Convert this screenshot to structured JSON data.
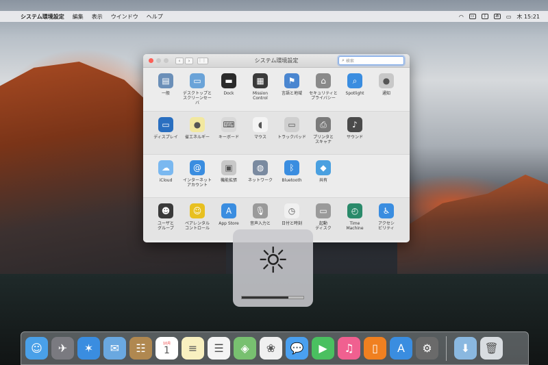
{
  "menubar": {
    "app_name": "システム環境設定",
    "items": [
      "編集",
      "表示",
      "ウインドウ",
      "ヘルプ"
    ],
    "clock": "木 15:21",
    "input_label": "あ"
  },
  "window": {
    "title": "システム環境設定",
    "search_placeholder": "検索"
  },
  "sections": [
    [
      {
        "label": "一般",
        "icon": "general-icon",
        "color": "#6b8fb8",
        "glyph": "▤"
      },
      {
        "label": "デスクトップと\nスクリーンセーバ",
        "icon": "desktop-icon",
        "color": "#6aa3d8",
        "glyph": "▭"
      },
      {
        "label": "Dock",
        "icon": "dock-icon",
        "color": "#2b2b2b",
        "glyph": "▬"
      },
      {
        "label": "Mission\nControl",
        "icon": "mission-control-icon",
        "color": "#3a3a3a",
        "glyph": "▦"
      },
      {
        "label": "言語と地域",
        "icon": "language-icon",
        "color": "#4a86d0",
        "glyph": "⚑"
      },
      {
        "label": "セキュリティと\nプライバシー",
        "icon": "security-icon",
        "color": "#8a8a8a",
        "glyph": "⌂"
      },
      {
        "label": "Spotlight",
        "icon": "spotlight-icon",
        "color": "#3a8de0",
        "glyph": "⌕"
      },
      {
        "label": "通知",
        "icon": "notifications-icon",
        "color": "#c8c8c8",
        "glyph": "●"
      }
    ],
    [
      {
        "label": "ディスプレイ",
        "icon": "display-icon",
        "color": "#2a6fc0",
        "glyph": "▭"
      },
      {
        "label": "省エネルギー",
        "icon": "energy-saver-icon",
        "color": "#f2e8a0",
        "glyph": "●"
      },
      {
        "label": "キーボード",
        "icon": "keyboard-icon",
        "color": "#d8d8d8",
        "glyph": "⌨"
      },
      {
        "label": "マウス",
        "icon": "mouse-icon",
        "color": "#f4f4f4",
        "glyph": "◖"
      },
      {
        "label": "トラックパッド",
        "icon": "trackpad-icon",
        "color": "#cfcfcf",
        "glyph": "▭"
      },
      {
        "label": "プリンタと\nスキャナ",
        "icon": "printer-icon",
        "color": "#7a7a7a",
        "glyph": "⎙"
      },
      {
        "label": "サウンド",
        "icon": "sound-icon",
        "color": "#4a4a4a",
        "glyph": "♪"
      }
    ],
    [
      {
        "label": "iCloud",
        "icon": "icloud-icon",
        "color": "#7ab8f0",
        "glyph": "☁"
      },
      {
        "label": "インターネット\nアカウント",
        "icon": "internet-accounts-icon",
        "color": "#3a8de0",
        "glyph": "@"
      },
      {
        "label": "機能拡張",
        "icon": "extensions-icon",
        "color": "#c8c8c8",
        "glyph": "▣"
      },
      {
        "label": "ネットワーク",
        "icon": "network-icon",
        "color": "#7a8aa0",
        "glyph": "◍"
      },
      {
        "label": "Bluetooth",
        "icon": "bluetooth-icon",
        "color": "#3a8de0",
        "glyph": "ᛒ"
      },
      {
        "label": "共有",
        "icon": "sharing-icon",
        "color": "#4aa0e0",
        "glyph": "◆"
      }
    ],
    [
      {
        "label": "ユーザと\nグループ",
        "icon": "users-icon",
        "color": "#3a3a3a",
        "glyph": "☻"
      },
      {
        "label": "ペアレンタル\nコントロール",
        "icon": "parental-controls-icon",
        "color": "#e8c020",
        "glyph": "☺"
      },
      {
        "label": "App Store",
        "icon": "app-store-icon",
        "color": "#3a8de0",
        "glyph": "A"
      },
      {
        "label": "音声入力と",
        "icon": "dictation-icon",
        "color": "#9a9a9a",
        "glyph": "🎙"
      },
      {
        "label": "日付と時刻",
        "icon": "date-time-icon",
        "color": "#f0f0f0",
        "glyph": "◷"
      },
      {
        "label": "起動\nディスク",
        "icon": "startup-disk-icon",
        "color": "#9a9a9a",
        "glyph": "▭"
      },
      {
        "label": "Time\nMachine",
        "icon": "time-machine-icon",
        "color": "#2a8a6a",
        "glyph": "◴"
      },
      {
        "label": "アクセシ\nビリティ",
        "icon": "accessibility-icon",
        "color": "#3a8de0",
        "glyph": "♿"
      }
    ]
  ],
  "hud": {
    "icon": "brightness-icon",
    "level": 0.75
  },
  "dock": {
    "apps": [
      {
        "name": "finder",
        "color": "#4aa0e8",
        "glyph": "☺"
      },
      {
        "name": "launchpad",
        "color": "#7a7a80",
        "glyph": "✈"
      },
      {
        "name": "safari",
        "color": "#3a8de0",
        "glyph": "✶"
      },
      {
        "name": "mail",
        "color": "#6aa8e0",
        "glyph": "✉"
      },
      {
        "name": "contacts",
        "color": "#b08850",
        "glyph": "☷"
      },
      {
        "name": "calendar",
        "color": "#ffffff",
        "glyph": "1",
        "month": "10月"
      },
      {
        "name": "notes",
        "color": "#f8f0c0",
        "glyph": "≡"
      },
      {
        "name": "reminders",
        "color": "#f4f4f4",
        "glyph": "☰"
      },
      {
        "name": "maps",
        "color": "#78c070",
        "glyph": "◈"
      },
      {
        "name": "photos",
        "color": "#f0f0f0",
        "glyph": "❀"
      },
      {
        "name": "messages",
        "color": "#4aa0f0",
        "glyph": "💬"
      },
      {
        "name": "facetime",
        "color": "#4ac060",
        "glyph": "▶"
      },
      {
        "name": "itunes",
        "color": "#f06090",
        "glyph": "♫"
      },
      {
        "name": "ibooks",
        "color": "#f08020",
        "glyph": "▯"
      },
      {
        "name": "app-store",
        "color": "#3a8de0",
        "glyph": "A"
      },
      {
        "name": "system-preferences",
        "color": "#6a6a6a",
        "glyph": "⚙"
      }
    ],
    "right": [
      {
        "name": "downloads",
        "color": "#8ab8e0",
        "glyph": "⬇"
      },
      {
        "name": "trash",
        "color": "#d8dce0",
        "glyph": "🗑"
      }
    ]
  }
}
